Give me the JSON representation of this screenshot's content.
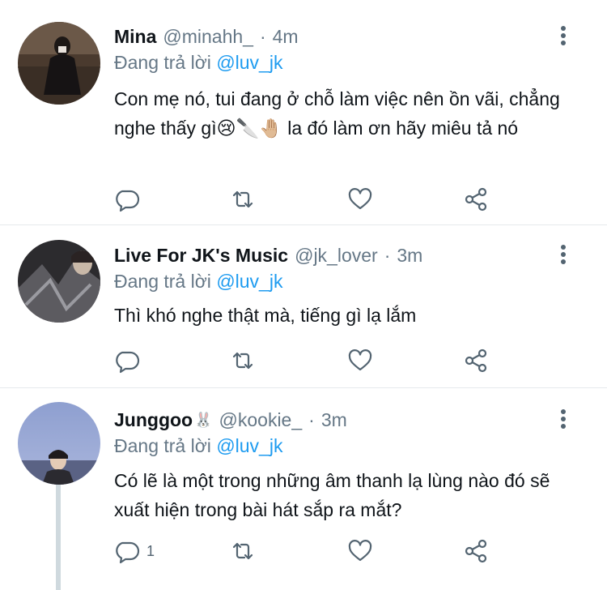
{
  "tweets": [
    {
      "name": "Mina",
      "handle": "@minahh_",
      "dot": "·",
      "time": "4m",
      "reply_prefix": "Đang trả lời",
      "reply_to": "@luv_jk",
      "text": "Con mẹ nó, tui đang ở chỗ làm việc nên ồn vãi, chẳng nghe thấy gì😢🔪🤚🏼 la đó làm ơn hãy miêu tả nó",
      "reply_count": ""
    },
    {
      "name": "Live For JK's Music",
      "handle": "@jk_lover",
      "dot": "·",
      "time": "3m",
      "reply_prefix": "Đang trả lời",
      "reply_to": "@luv_jk",
      "text": "Thì khó nghe thật mà, tiếng gì lạ lắm",
      "reply_count": ""
    },
    {
      "name": "Junggoo",
      "name_emoji": "🐰",
      "handle": "@kookie_",
      "dot": "·",
      "time": "3m",
      "reply_prefix": "Đang trả lời",
      "reply_to": "@luv_jk",
      "text": "Có lẽ là một trong những âm thanh lạ lùng nào đó sẽ xuất hiện trong bài hát sắp ra mắt?",
      "reply_count": "1"
    }
  ],
  "icons": {
    "reply": "comment-icon",
    "retweet": "retweet-icon",
    "like": "heart-icon",
    "share": "share-icon",
    "more": "more-vertical-icon"
  },
  "colors": {
    "text": "#0f1419",
    "muted": "#657786",
    "link": "#1d9bf0",
    "divider": "#e6e9ec",
    "icon": "#536471",
    "thread_line": "#cfd9de"
  }
}
